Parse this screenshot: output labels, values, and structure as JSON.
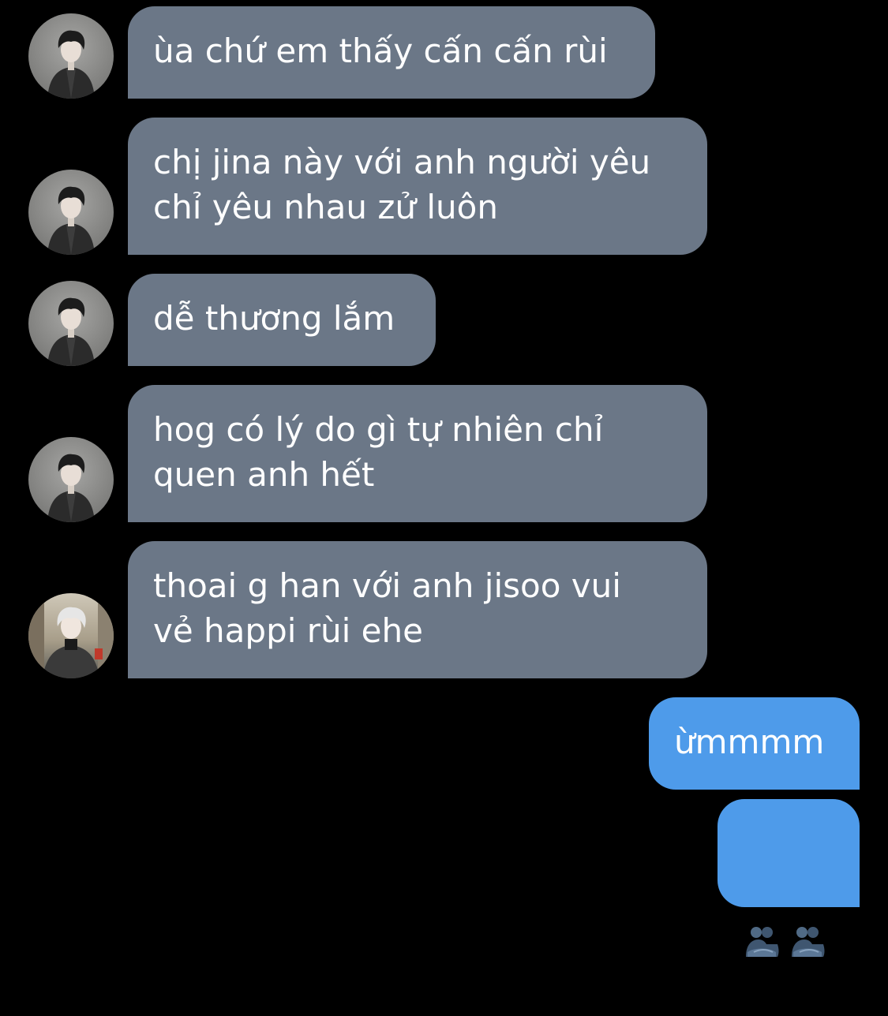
{
  "messages": [
    {
      "side": "incoming",
      "avatar": "dark-haired-boy-avatar",
      "text": "ùa chứ em thấy cấn cấn rùi"
    },
    {
      "side": "incoming",
      "avatar": "dark-haired-boy-avatar",
      "text": "chị jina này với anh người yêu\nchỉ yêu nhau zử luôn"
    },
    {
      "side": "incoming",
      "avatar": "dark-haired-boy-avatar",
      "text": "dễ thương lắm"
    },
    {
      "side": "incoming",
      "avatar": "dark-haired-boy-avatar",
      "text": "hog có lý do gì tự nhiên chỉ\nquen anh hết"
    },
    {
      "side": "incoming",
      "avatar": "silver-haired-boy-avatar",
      "text": "thoai g han với anh jisoo vui\nvẻ happi rùi ehe"
    },
    {
      "side": "outgoing",
      "text": "ừmmmm"
    },
    {
      "side": "outgoing",
      "emoji": [
        "people-hugging-icon",
        "people-hugging-icon"
      ]
    }
  ],
  "colors": {
    "background": "#000000",
    "incoming_bubble": "#6b7787",
    "outgoing_bubble": "#4e9bea",
    "text": "#ffffff"
  }
}
